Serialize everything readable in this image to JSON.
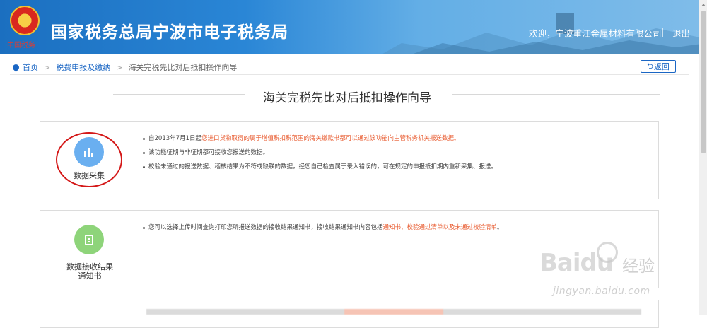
{
  "header": {
    "emblem_text": "中国税务",
    "title": "国家税务总局宁波市电子税务局",
    "welcome": "欢迎，宁波重江金属材料有限公司",
    "separator": "|",
    "logout": "退出"
  },
  "breadcrumb": {
    "items": [
      "首页",
      "税费申报及缴纳",
      "海关完税先比对后抵扣操作向导"
    ],
    "separator": ">"
  },
  "back_button": "返回",
  "page_title": "海关完税先比对后抵扣操作向导",
  "cards": [
    {
      "icon": "bar-chart-icon",
      "label": "数据采集",
      "bullets": [
        {
          "parts": [
            "自2013年7月1日起",
            "您进口货物取得的属于增值税扣税范围的海关缴款书都可以通过该功能向主管税务机关报送数据。",
            ""
          ]
        },
        {
          "parts": [
            "该功能征期与非征期都可接收您报送的数据。",
            "",
            ""
          ]
        },
        {
          "parts": [
            "校验未通过的报送数据、稽核结果为不符或缺联的数据，经您自己检查属于录入错误的，可在规定的申报抵扣期内重新采集、报送。",
            "",
            ""
          ]
        }
      ]
    },
    {
      "icon": "document-icon",
      "label_line1": "数据接收结果",
      "label_line2": "通知书",
      "bullets": [
        {
          "parts": [
            "您可以选择上传时间查询打印您所报送数据的接收结果通知书，接收结果通知书内容包括",
            "通知书、校验通过清单以及未通过校验清单",
            "。"
          ]
        }
      ]
    }
  ],
  "watermark": {
    "logo": "Baidu",
    "text": "经验",
    "url": "jingyan.baidu.com"
  },
  "colors": {
    "header_blue": "#1b6fc0",
    "link_blue": "#1a66c4",
    "highlight_orange": "#e85a2e",
    "annotation_red": "#d41818",
    "icon_blue": "#6aaff0",
    "icon_green": "#8ed47a"
  }
}
